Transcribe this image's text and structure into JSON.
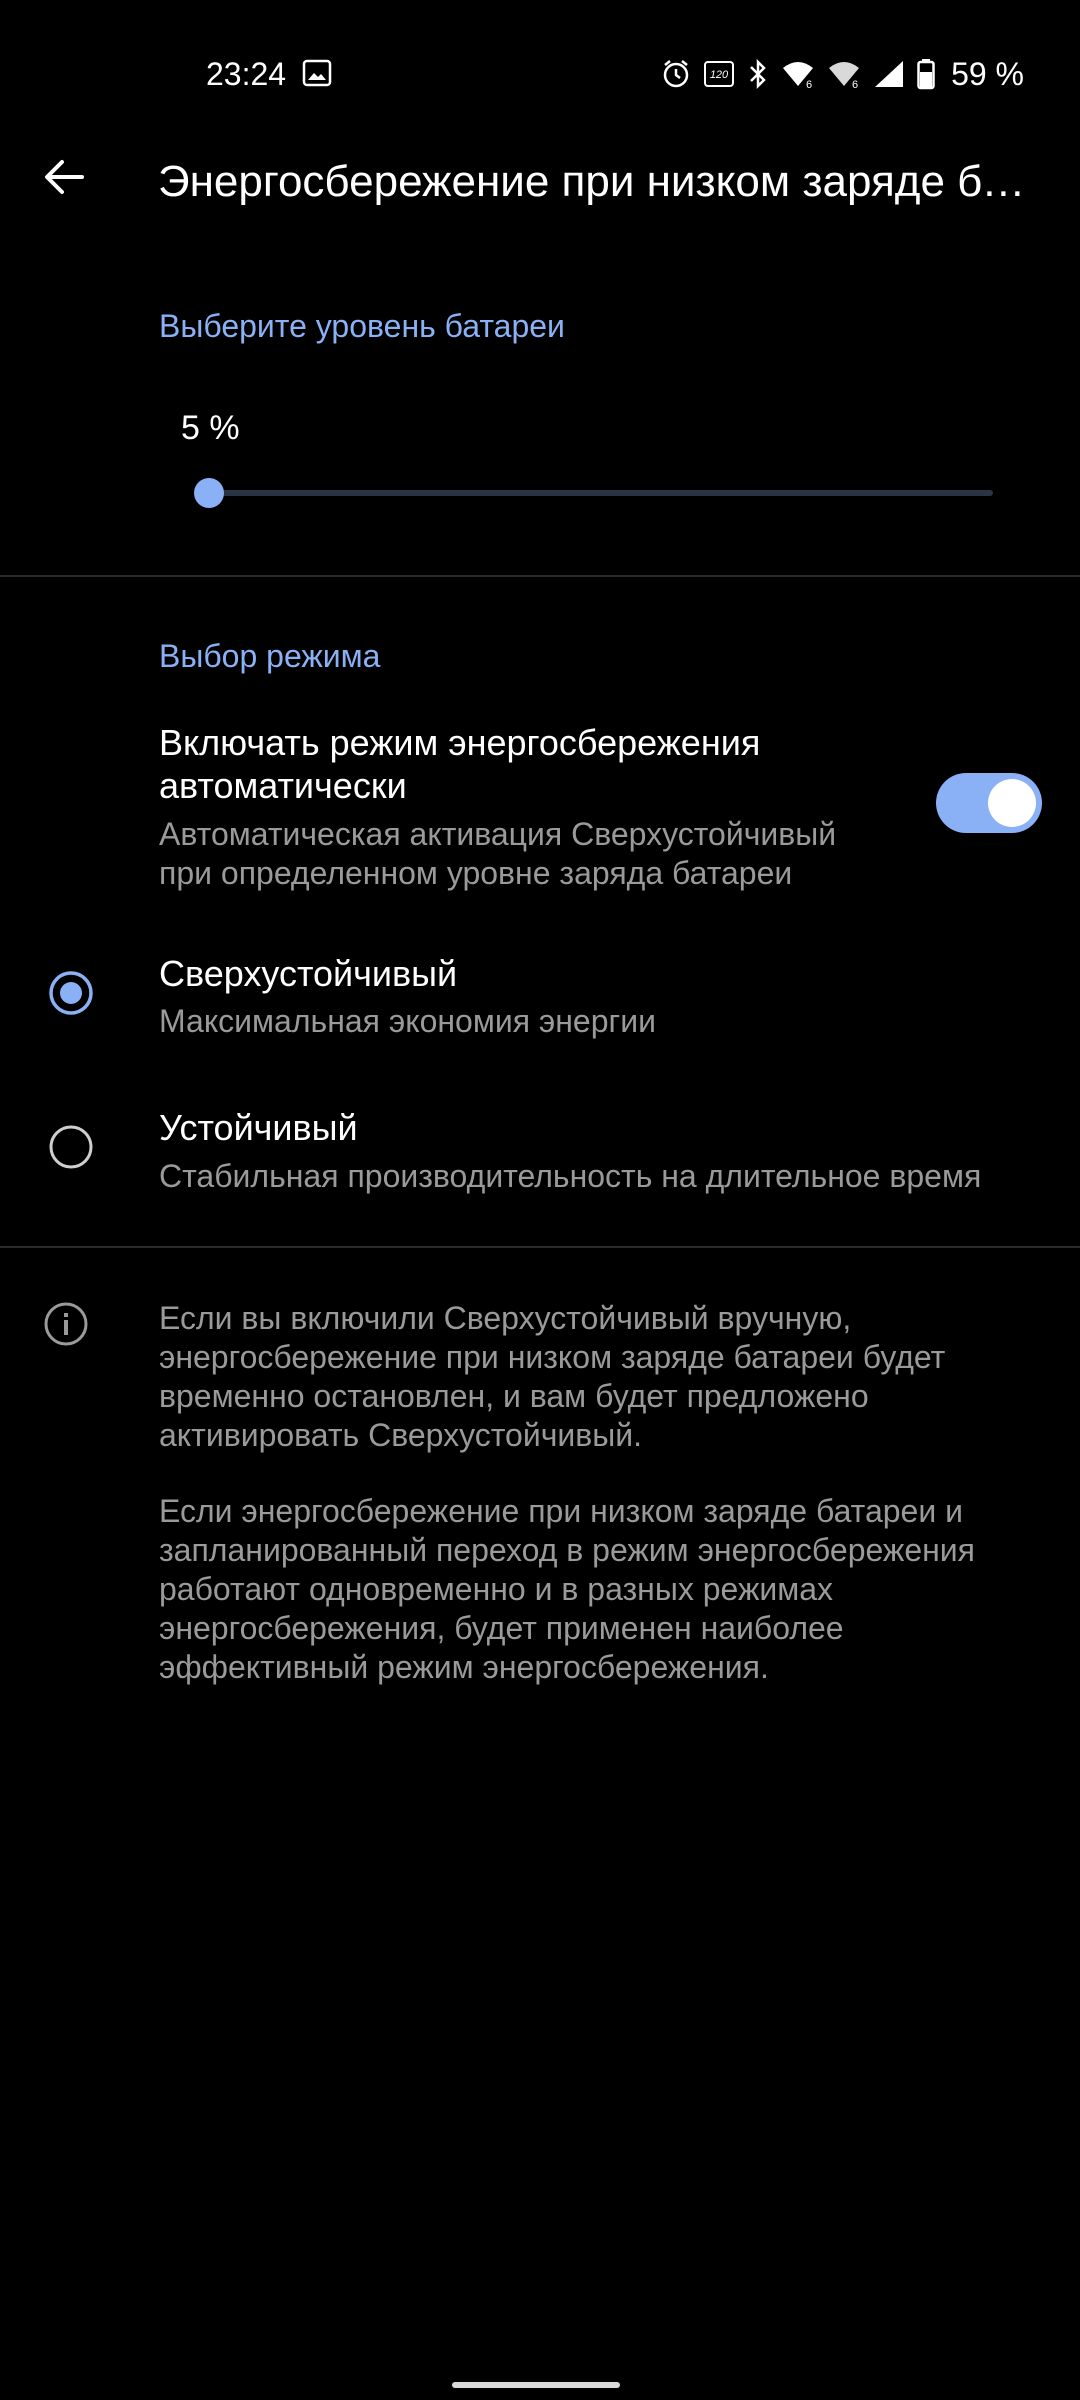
{
  "status_bar": {
    "time": "23:24",
    "battery_percent": "59 %"
  },
  "header": {
    "title": "Энергосбережение при низком заряде батареи"
  },
  "battery_level_section": {
    "header": "Выберите уровень батареи",
    "slider_value_text": "5 %",
    "slider_fraction": 0.0
  },
  "mode_section": {
    "header": "Выбор режима",
    "auto_toggle": {
      "title_line1": "Включать режим энергосбережения",
      "title_line2": "автоматически",
      "subtitle_line1": "Автоматическая активация Сверхустойчивый",
      "subtitle_line2": "при определенном уровне заряда батареи",
      "enabled": true
    },
    "options": [
      {
        "title": "Сверхустойчивый",
        "subtitle": "Максимальная экономия энергии",
        "selected": true
      },
      {
        "title": "Устойчивый",
        "subtitle": "Стабильная производительность на длительное время",
        "selected": false
      }
    ]
  },
  "info": {
    "paragraph1": [
      "Если вы включили Сверхустойчивый вручную,",
      "энергосбережение при низком заряде батареи будет",
      "временно остановлен, и вам будет предложено",
      "активировать Сверхустойчивый."
    ],
    "paragraph2": [
      "Если энергосбережение при низком заряде батареи и",
      "запланированный переход в режим энергосбережения",
      "работают одновременно и в разных режимах",
      "энергосбережения, будет применен наиболее",
      "эффективный режим энергосбережения."
    ]
  },
  "colors": {
    "accent": "#8ab0f5",
    "background": "#000000",
    "secondary_text": "#9a9a9a"
  },
  "icons": {
    "back": "arrow-left-icon",
    "info": "info-circle-icon",
    "alarm": "alarm-icon",
    "refresh_rate": "refresh-rate-120-icon",
    "bluetooth": "bluetooth-icon",
    "wifi": "wifi-6-icon",
    "signal": "cell-signal-icon",
    "battery": "battery-icon",
    "gallery": "gallery-icon"
  }
}
